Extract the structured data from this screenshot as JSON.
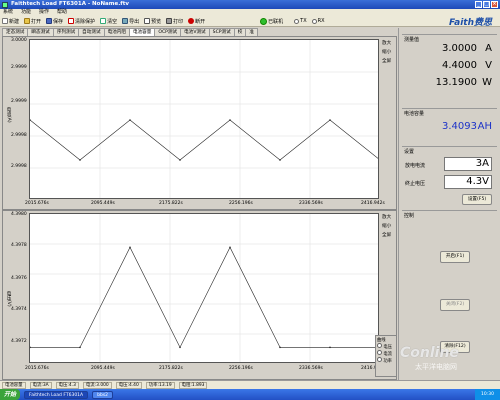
{
  "window": {
    "title": "Faithtech Load FT6301A - NoName.ftv"
  },
  "menu": [
    "系统",
    "功能",
    "操作",
    "帮助"
  ],
  "toolbar": {
    "new": "新建",
    "open": "打开",
    "save": "保存",
    "clear_prot": "清除保护",
    "clear_data": "清空",
    "export": "导出",
    "preview": "预览",
    "print": "打印",
    "disconnect": "断开",
    "connected": "已联机",
    "tx": "TX",
    "rx": "RX"
  },
  "brand": {
    "logo_text": "Faith费思"
  },
  "tabs": [
    "定态测试",
    "瞬态测试",
    "序列测试",
    "自动测试",
    "电池内阻",
    "电池容量",
    "OCP测试",
    "电池V测试",
    "SCP测试",
    "校",
    "准"
  ],
  "active_tab_index": 5,
  "top_chart": {
    "ylabel": "电流(A)",
    "yticks": [
      "3.0000",
      "2.9999",
      "2.9999",
      "2.9998",
      "2.9998"
    ],
    "xticks": [
      "2015.676s",
      "2095.449s",
      "2175.822s",
      "2256.196s",
      "2336.569s",
      "2416.942s"
    ],
    "side_items": [
      "放大",
      "缩小",
      "全屏"
    ]
  },
  "bottom_chart": {
    "ylabel": "电压(V)",
    "yticks": [
      "4.3980",
      "4.3978",
      "4.3976",
      "4.3974",
      "4.3972"
    ],
    "xticks": [
      "2015.676s",
      "2095.449s",
      "2175.822s",
      "2256.196s",
      "2336.569s",
      "2416.942s"
    ],
    "side_items": [
      "放大",
      "缩小",
      "全屏"
    ],
    "legend_title": "曲线",
    "legend_items": [
      "电压",
      "电流",
      "功率"
    ]
  },
  "chart_data": [
    {
      "type": "line",
      "title": "",
      "ylabel": "电流(A)",
      "xlabel": "",
      "xlim": [
        2015.676,
        2416.942
      ],
      "ylim": [
        2.9998,
        3.0
      ],
      "series": [
        {
          "name": "",
          "values": [
            2.9999,
            2.99985,
            2.9999,
            2.99985,
            2.9999,
            2.99985,
            2.9999,
            2.99985
          ]
        }
      ]
    },
    {
      "type": "line",
      "title": "",
      "ylabel": "电压(V)",
      "xlabel": "",
      "xlim": [
        2015.676,
        2416.942
      ],
      "ylim": [
        4.3971,
        4.398
      ],
      "series": [
        {
          "name": "",
          "values": [
            4.3972,
            4.3972,
            4.3978,
            4.3972,
            4.3978,
            4.3972,
            4.3972,
            4.3972
          ]
        }
      ]
    }
  ],
  "measure": {
    "title": "测量值",
    "current": "3.0000",
    "current_unit": "A",
    "voltage": "4.4000",
    "voltage_unit": "V",
    "power": "13.1900",
    "power_unit": "W"
  },
  "capacity": {
    "title": "电池容量",
    "value": "3.4093",
    "unit": "AH"
  },
  "settings": {
    "title": "设置",
    "discharge_label": "放电电流",
    "discharge_value": "3",
    "discharge_unit": "A",
    "cutoff_label": "终止电压",
    "cutoff_value": "4.3",
    "cutoff_unit": "V",
    "set_button": "设置(F5)"
  },
  "control": {
    "title": "控制",
    "start": "开启(F1)",
    "stop": "关闭(F2)",
    "clear": "清除(F12)"
  },
  "statusbar": [
    "电池容量",
    "电流:3A",
    "电压:4.3",
    "电流:3.000",
    "电压:4.40",
    "功率:13.19",
    "电阻:1.893"
  ],
  "taskbar": {
    "start": "开始",
    "tasks": [
      "Faithtech Load FT6301A",
      "bbs2"
    ],
    "clock": "10:30"
  },
  "watermark": {
    "brand": "Conline",
    "cn": "太平洋电脑网"
  }
}
